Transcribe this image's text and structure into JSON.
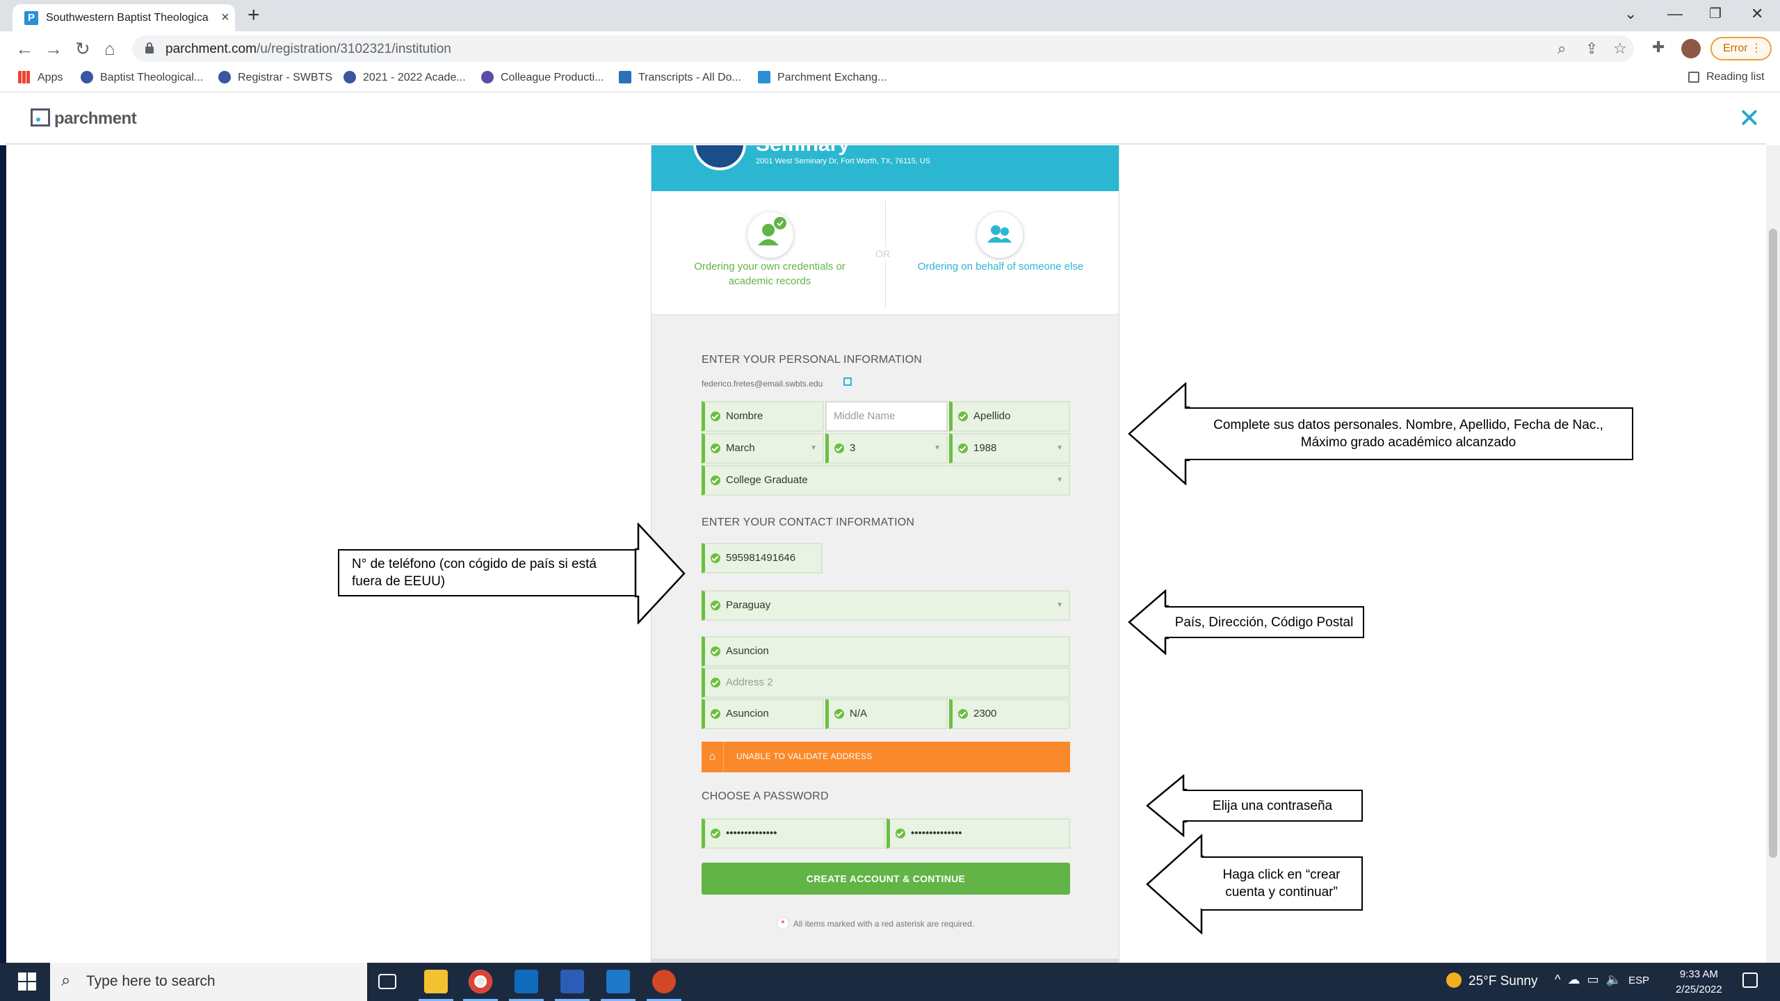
{
  "browser": {
    "tab_title": "Southwestern Baptist Theologica",
    "url_host": "parchment.com",
    "url_path": "/u/registration/3102321/institution",
    "error_label": "Error",
    "bookmarks": [
      {
        "label": "Apps",
        "color": "#ea4335"
      },
      {
        "label": "Baptist Theological...",
        "color": "#3b55a0"
      },
      {
        "label": "Registrar - SWBTS",
        "color": "#3b55a0"
      },
      {
        "label": "2021 - 2022 Acade...",
        "color": "#3b55a0"
      },
      {
        "label": "Colleague Producti...",
        "color": "#5b4aa8"
      },
      {
        "label": "Transcripts - All Do...",
        "color": "#2a6fb8"
      },
      {
        "label": "Parchment Exchang...",
        "color": "#2b8fd6"
      }
    ],
    "reading_list": "Reading list"
  },
  "page": {
    "logo": "parchment",
    "institution": {
      "name": "Seminary",
      "address": "2001 West Seminary Dr, Fort Worth, TX, 76115, US"
    },
    "choice": {
      "own": "Ordering your own credentials or academic records",
      "or": "OR",
      "behalf": "Ordering on behalf of someone else"
    },
    "personal_title": "ENTER YOUR PERSONAL INFORMATION",
    "email": "federico.fretes@email.swbts.edu",
    "first_name": "Nombre",
    "middle_placeholder": "Middle Name",
    "last_name": "Apellido",
    "birth_month": "March",
    "birth_day": "3",
    "birth_year": "1988",
    "education": "College Graduate",
    "contact_title": "ENTER YOUR CONTACT INFORMATION",
    "phone": "595981491646",
    "country": "Paraguay",
    "address1": "Asuncion",
    "address2_placeholder": "Address 2",
    "city": "Asuncion",
    "state": "N/A",
    "zip": "2300",
    "warning": "UNABLE TO VALIDATE ADDRESS",
    "password_title": "CHOOSE A PASSWORD",
    "password": "••••••••••••••",
    "password_confirm": "••••••••••••••",
    "create_button": "CREATE ACCOUNT & CONTINUE",
    "required_note": "All items marked with a red asterisk are required."
  },
  "annotations": {
    "personal": "Complete sus datos personales. Nombre, Apellido, Fecha de Nac., Máximo grado académico alcanzado",
    "phone": "N° de teléfono (con cógido de país si está fuera de EEUU)",
    "address": "País, Dirección, Código Postal",
    "password": "Elija una contraseña",
    "create": "Haga click en “crear cuenta y continuar”"
  },
  "taskbar": {
    "search_placeholder": "Type here to search",
    "weather": "25°F  Sunny",
    "language": "ESP",
    "time": "9:33 AM",
    "date": "2/25/2022"
  }
}
